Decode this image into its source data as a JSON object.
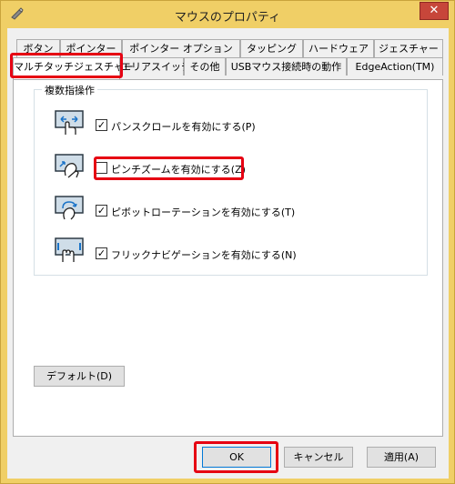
{
  "window": {
    "title": "マウスのプロパティ",
    "close_glyph": "✕"
  },
  "tabs_row1": [
    "ボタン",
    "ポインター",
    "ポインター オプション",
    "タッピング",
    "ハードウェア",
    "ジェスチャー"
  ],
  "tabs_row2": [
    "マルチタッチジェスチャー",
    "エリアスイッチ",
    "その他",
    "USBマウス接続時の動作",
    "EdgeAction(TM)"
  ],
  "group": {
    "title": "複数指操作"
  },
  "options": [
    {
      "label": "パンスクロールを有効にする(P)",
      "checked": true,
      "mark": "✓",
      "icon": "pan-scroll-icon"
    },
    {
      "label": "ピンチズームを有効にする(Z)",
      "checked": false,
      "mark": "",
      "icon": "pinch-zoom-icon"
    },
    {
      "label": "ピボットローテーションを有効にする(T)",
      "checked": true,
      "mark": "✓",
      "icon": "pivot-rotation-icon"
    },
    {
      "label": "フリックナビゲーションを有効にする(N)",
      "checked": true,
      "mark": "✓",
      "icon": "flick-navigation-icon"
    }
  ],
  "buttons": {
    "default": "デフォルト(D)",
    "ok": "OK",
    "cancel": "キャンセル",
    "apply": "適用(A)"
  },
  "colors": {
    "highlight": "#e60012",
    "titlebar": "#f0cf66",
    "close": "#c7463a"
  }
}
